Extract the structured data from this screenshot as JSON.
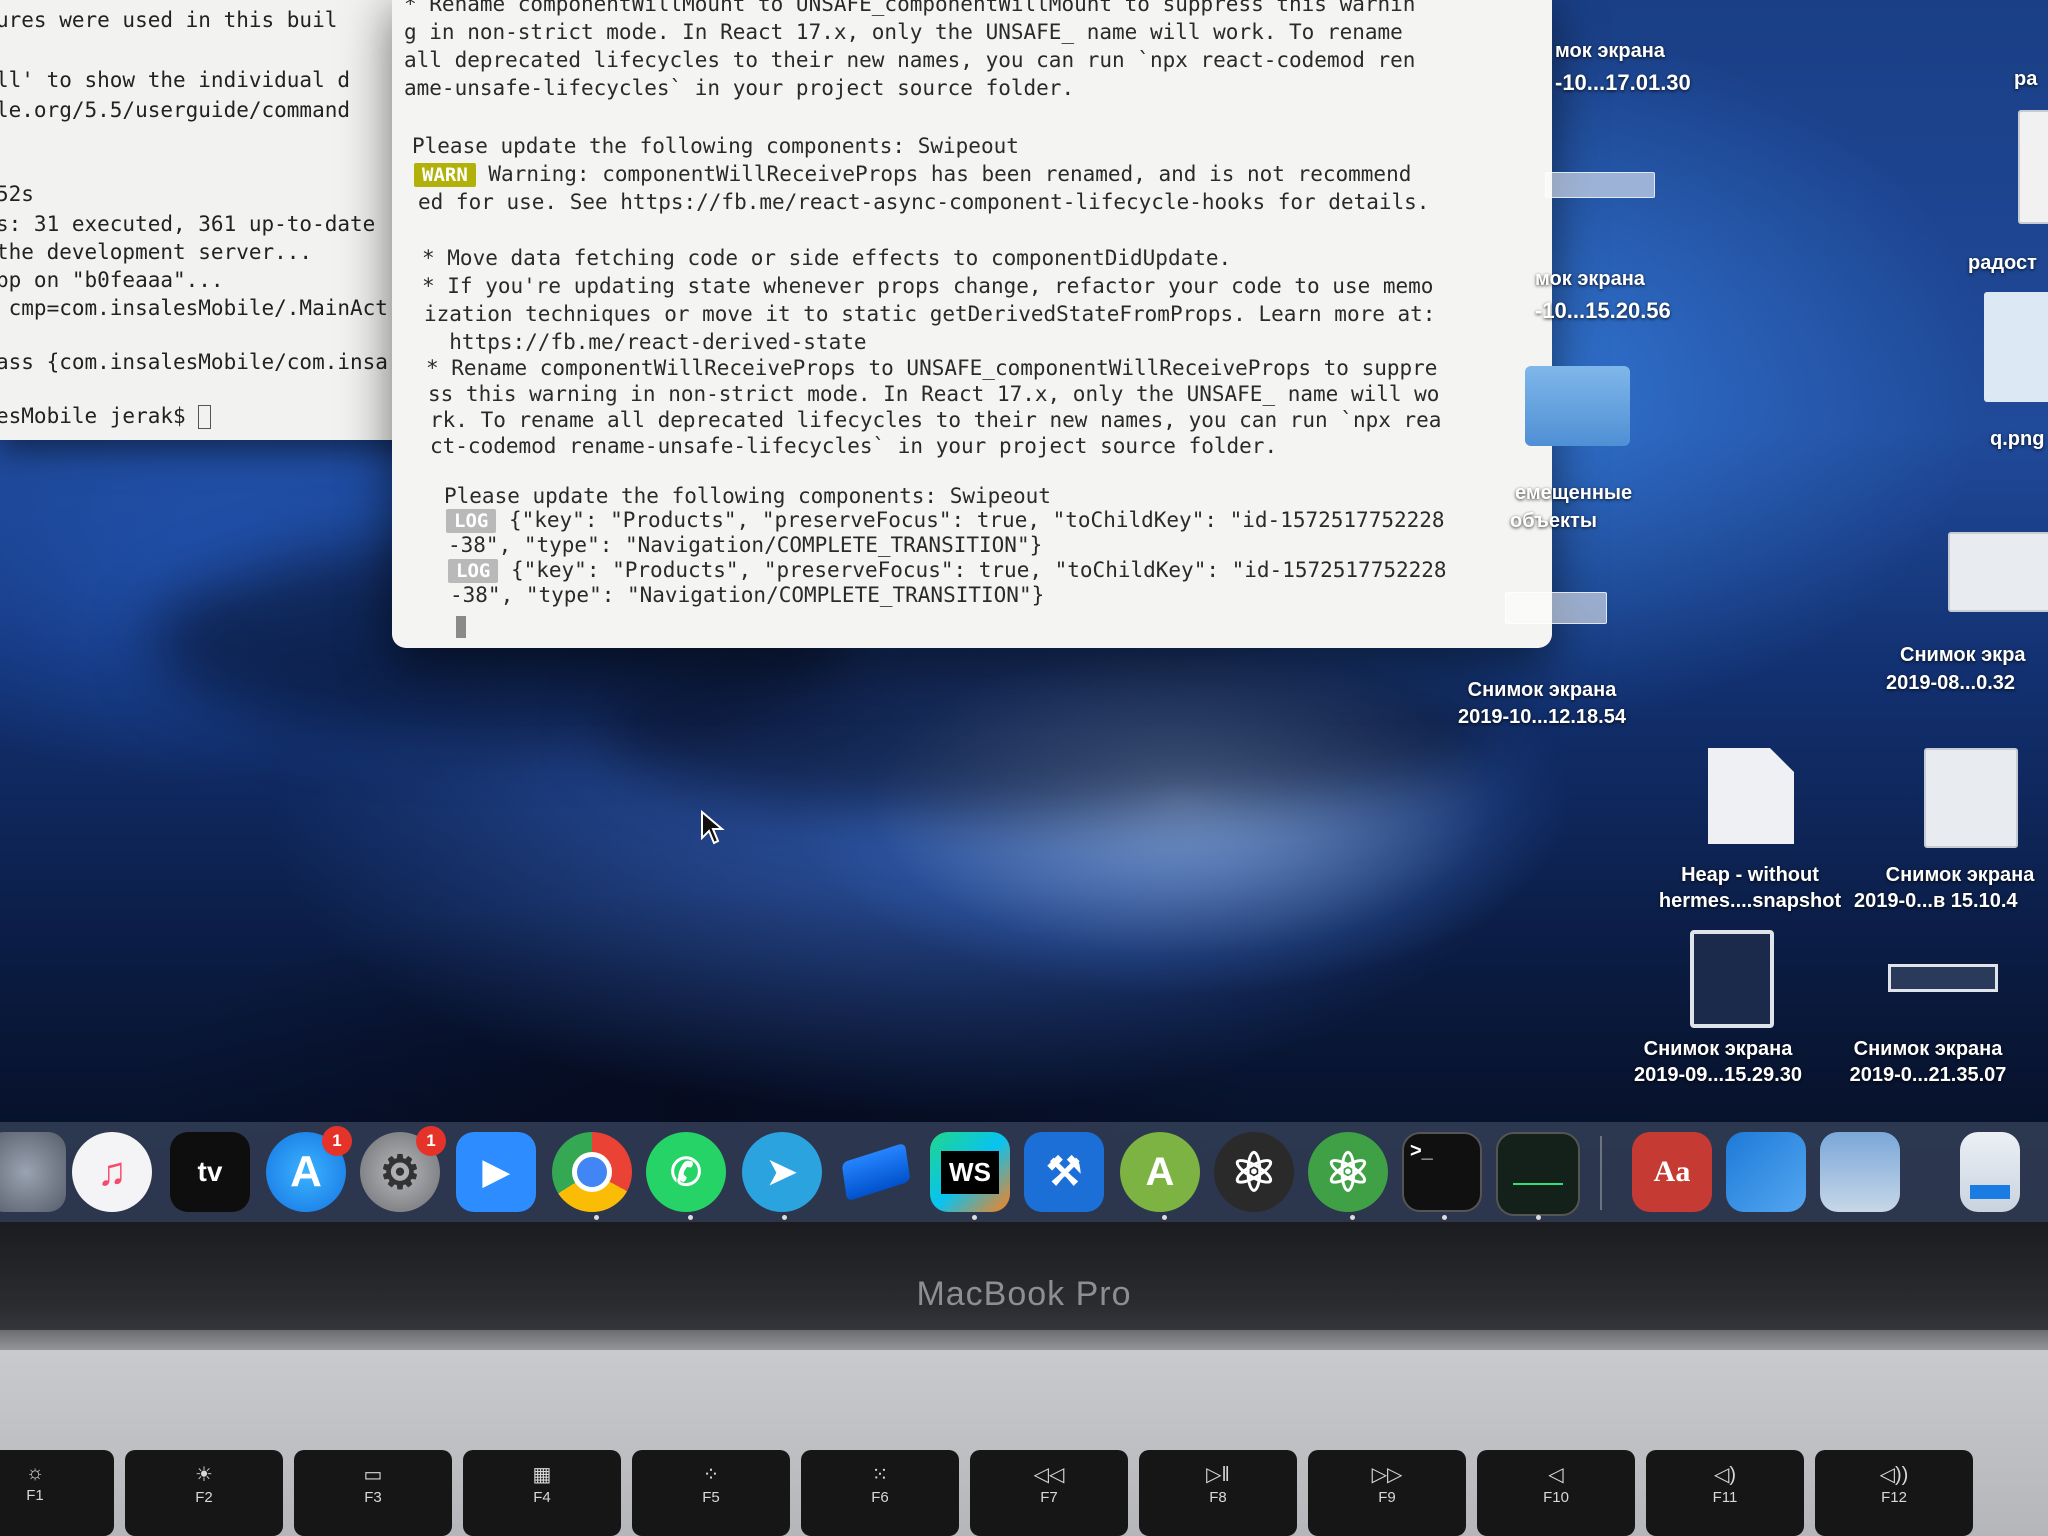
{
  "terminal_left": {
    "lines": [
      "ures were used in this buil",
      "",
      "ll' to show the individual d",
      "le.org/5.5/userguide/command",
      "",
      "",
      "52s",
      "s: 31 executed, 361 up-to-date",
      "the development server...",
      "pp on \"b0feaaa\"...",
      " cmp=com.insalesMobile/.MainAct",
      "",
      "ass {com.insalesMobile/com.insa",
      "",
      "esMobile jerak$ "
    ]
  },
  "terminal_main": {
    "lines": [
      "* Rename componentWillMount to UNSAFE_componentWillMount to suppress this warnin",
      "g in non-strict mode. In React 17.x, only the UNSAFE_ name will work. To rename",
      "all deprecated lifecycles to their new names, you can run `npx react-codemod ren",
      "ame-unsafe-lifecycles` in your project source folder.",
      "",
      "Please update the following components: Swipeout"
    ],
    "warn_badge": "WARN",
    "warn_line1": " Warning: componentWillReceiveProps has been renamed, and is not recommend",
    "warn_line2": "ed for use. See https://fb.me/react-async-component-lifecycle-hooks for details.",
    "lines2": [
      "* Move data fetching code or side effects to componentDidUpdate.",
      "* If you're updating state whenever props change, refactor your code to use memo",
      "ization techniques or move it to static getDerivedStateFromProps. Learn more at:",
      "  https://fb.me/react-derived-state",
      "* Rename componentWillReceiveProps to UNSAFE_componentWillReceiveProps to suppre",
      "ss this warning in non-strict mode. In React 17.x, only the UNSAFE_ name will wo",
      "rk. To rename all deprecated lifecycles to their new names, you can run `npx rea",
      "ct-codemod rename-unsafe-lifecycles` in your project source folder.",
      "",
      "Please update the following components: Swipeout"
    ],
    "log_badge": "LOG",
    "log1_line1": " {\"key\": \"Products\", \"preserveFocus\": true, \"toChildKey\": \"id-1572517752228",
    "log1_line2": "-38\", \"type\": \"Navigation/COMPLETE_TRANSITION\"}",
    "log2_line1": " {\"key\": \"Products\", \"preserveFocus\": true, \"toChildKey\": \"id-1572517752228",
    "log2_line2": "-38\", \"type\": \"Navigation/COMPLETE_TRANSITION\"}"
  },
  "desktop": {
    "labels": {
      "shot1_a": "мок экрана",
      "shot1_b": "-10...17.01.30",
      "shot2_a": "мок экрана",
      "shot2_b": "-10...15.20.56",
      "moved_a": "емещенные",
      "moved_b": "объекты",
      "shot3_a": "Снимок экрана",
      "shot3_b": "2019-10...12.18.54",
      "heap_a": "Heap - without",
      "heap_b": "hermes....snapshot",
      "shot4_a": "Снимок экрана",
      "shot4_b": "2019-0...в 15.10.4",
      "shot5_a": "Снимок экрана",
      "shot5_b": "2019-09...15.29.30",
      "shot6_a": "Снимок экрана",
      "shot6_b": "2019-0...21.35.07",
      "shot7_a": "Снимок экра",
      "shot7_b": "2019-08...0.32",
      "rado1": "ра",
      "rado2": "радост",
      "qpng": "q.png"
    }
  },
  "dock": {
    "items": [
      {
        "name": "Launchpad",
        "label": ""
      },
      {
        "name": "Music",
        "label": "♫"
      },
      {
        "name": "Apple TV",
        "label": "tv"
      },
      {
        "name": "App Store",
        "label": "A",
        "badge": "1"
      },
      {
        "name": "System Preferences",
        "label": "⚙",
        "badge": "1"
      },
      {
        "name": "Zoom",
        "label": "▶"
      },
      {
        "name": "Chrome",
        "label": ""
      },
      {
        "name": "WhatsApp",
        "label": "✆"
      },
      {
        "name": "Telegram",
        "label": "➤"
      },
      {
        "name": "Sourcetree",
        "label": ""
      },
      {
        "name": "WebStorm",
        "label": "WS"
      },
      {
        "name": "Xcode",
        "label": "⚒"
      },
      {
        "name": "Android Studio",
        "label": "A"
      },
      {
        "name": "React Native Debugger",
        "label": "⚛"
      },
      {
        "name": "Atom",
        "label": "⚛"
      },
      {
        "name": "Terminal",
        "label": ">_"
      },
      {
        "name": "Activity Monitor",
        "label": ""
      },
      {
        "name": "Dictionary",
        "label": "Aa"
      },
      {
        "name": "Simulator",
        "label": ""
      },
      {
        "name": "Preview",
        "label": ""
      },
      {
        "name": "Downloads",
        "label": ""
      }
    ]
  },
  "laptop": {
    "brand": "MacBook Pro",
    "keys": [
      "F1",
      "F2",
      "F3",
      "F4",
      "F5",
      "F6",
      "F7",
      "F8",
      "F9",
      "F10",
      "F11",
      "F12"
    ],
    "key_glyphs": [
      "☼",
      "☀",
      "▭",
      "▦",
      "⁘",
      "⁙",
      "◁◁",
      "▷‖",
      "▷▷",
      "◁",
      "◁)",
      "◁))"
    ]
  }
}
